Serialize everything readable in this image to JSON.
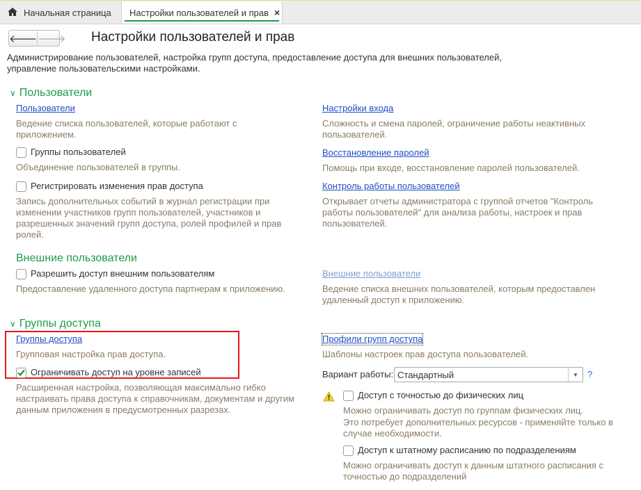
{
  "tabs": [
    {
      "label": "Начальная страница",
      "icon": "home-icon"
    },
    {
      "label": "Настройки пользователей и прав",
      "close": "×"
    }
  ],
  "nav": {
    "back": "🡐",
    "forward": "🡒"
  },
  "page_title": "Настройки пользователей и прав",
  "intro": [
    "Администрирование пользователей, настройка групп доступа, предоставление доступа для внешних пользователей,",
    "управление пользовательскими настройками."
  ],
  "sections": {
    "users": {
      "title": "Пользователи",
      "users_link": "Пользователи",
      "users_desc": [
        "Ведение списка пользователей, которые работают с",
        "приложением."
      ],
      "groups_cb": "Группы пользователей",
      "groups_desc": "Объединение пользователей в группы.",
      "log_cb": "Регистрировать изменения прав доступа",
      "log_desc": [
        "Запись дополнительных событий в журнал регистрации при",
        "изменении участников групп пользователей, участников и",
        "разрешенных значений групп доступа, ролей профилей и прав",
        "ролей."
      ],
      "login_link": "Настройки входа",
      "login_desc": [
        "Сложность и смена паролей, ограничение работы неактивных",
        "пользователей."
      ],
      "recovery_link": "Восстановление паролей",
      "recovery_desc": "Помощь при входе, восстановление паролей пользователей.",
      "control_link": "Контроль работы пользователей",
      "control_desc": [
        "Открывает отчеты администратора с группой отчетов \"Контроль",
        "работы пользователей\" для анализа работы, настроек и прав",
        "пользователей."
      ]
    },
    "external": {
      "title": "Внешние пользователи",
      "allow_cb": "Разрешить доступ внешним пользователям",
      "allow_desc": "Предоставление удаленного доступа партнерам к приложению.",
      "ext_link": "Внешние пользователи",
      "ext_desc": [
        "Ведение списка внешних пользователей, которым предоставлен",
        "удаленный доступ к приложению."
      ]
    },
    "access": {
      "title": "Группы доступа",
      "groups_link": "Группы доступа",
      "groups_desc": "Групповая настройка прав доступа.",
      "restrict_cb": "Ограничивать доступ на уровне записей",
      "restrict_checked": true,
      "restrict_desc": [
        "Расширенная настройка, позволяющая максимально гибко",
        "настраивать права доступа к справочникам, документам и другим",
        "данным приложения в предусмотренных разрезах."
      ],
      "profiles_link": "Профили групп доступа",
      "profiles_desc": "Шаблоны настроек прав доступа пользователей.",
      "mode_label": "Вариант работы:",
      "mode_value": "Стандартный",
      "help": "?",
      "persons_cb": "Доступ с точностью до физических лиц",
      "persons_desc": [
        "Можно ограничивать доступ по группам физических лиц.",
        "Это потребует дополнительных ресурсов - применяйте только в",
        "случае необходимости."
      ],
      "staff_cb": "Доступ к штатному расписанию по подразделениям",
      "staff_desc": [
        "Можно ограничивать доступ к данным штатного расписания с",
        "точностью до подразделений"
      ]
    }
  },
  "colors": {
    "accent": "#1e9b47",
    "link": "#1c4fc6",
    "desc": "#8a7b66",
    "highlight": "#e8141b"
  }
}
